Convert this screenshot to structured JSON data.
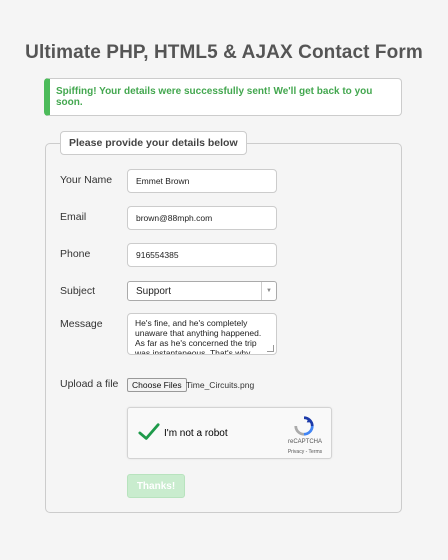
{
  "page_title": "Ultimate PHP, HTML5 & AJAX Contact Form",
  "alert": {
    "message": "Spiffing! Your details were successfully sent! We'll get back to you soon."
  },
  "form": {
    "legend": "Please provide your details below",
    "fields": {
      "name": {
        "label": "Your Name",
        "value": "Emmet Brown"
      },
      "email": {
        "label": "Email",
        "value": "brown@88mph.com"
      },
      "phone": {
        "label": "Phone",
        "value": "916554385"
      },
      "subject": {
        "label": "Subject",
        "selected": "Support"
      },
      "message": {
        "label": "Message",
        "value": "He's fine, and he's completely unaware that anything happened. As far as he's concerned the trip was instantaneous. That's why Einstein's"
      },
      "upload": {
        "label": "Upload a file",
        "button": "Choose Files",
        "filename": "Time_Circuits.png"
      }
    },
    "captcha": {
      "label": "I'm not a robot",
      "brand": "reCAPTCHA",
      "links": "Privacy - Terms"
    },
    "submit_label": "Thanks!"
  },
  "colors": {
    "success": "#4cbb5a",
    "submit_disabled": "#c9ecce",
    "captcha_check": "#1e9a4a"
  },
  "icons": [
    "checkmark-icon",
    "recaptcha-logo-icon",
    "chevron-down-icon"
  ]
}
